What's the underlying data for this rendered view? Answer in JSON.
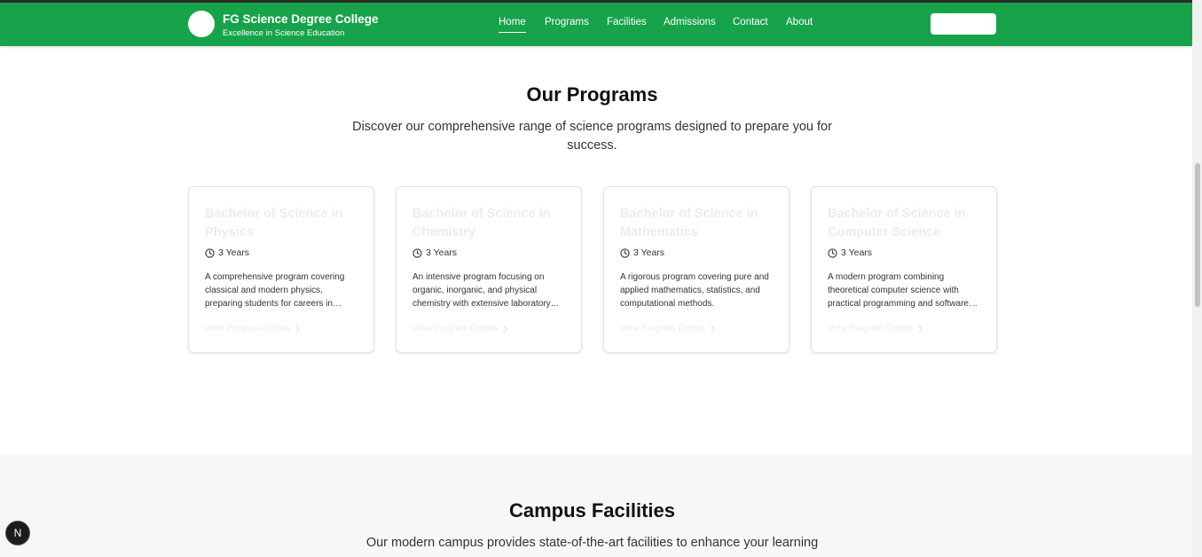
{
  "brand": {
    "title": "FG Science Degree College",
    "subtitle": "Excellence in Science Education"
  },
  "nav": {
    "links": [
      "Home",
      "Programs",
      "Facilities",
      "Admissions",
      "Contact",
      "About"
    ],
    "active": "Home"
  },
  "programs": {
    "title": "Our Programs",
    "description": "Discover our comprehensive range of science programs designed to prepare you for success.",
    "cards": [
      {
        "title": "Bachelor of Science in Physics",
        "duration": "3 Years",
        "description": "A comprehensive program covering classical and modern physics, preparing students for careers in research, industry, and academia.",
        "link": "View Program Details"
      },
      {
        "title": "Bachelor of Science in Chemistry",
        "duration": "3 Years",
        "description": "An intensive program focusing on organic, inorganic, and physical chemistry with extensive laboratory work.",
        "link": "View Program Details"
      },
      {
        "title": "Bachelor of Science in Mathematics",
        "duration": "3 Years",
        "description": "A rigorous program covering pure and applied mathematics, statistics, and computational methods.",
        "link": "View Program Details"
      },
      {
        "title": "Bachelor of Science in Computer Science",
        "duration": "3 Years",
        "description": "A modern program combining theoretical computer science with practical programming and software development.",
        "link": "View Program Details"
      }
    ]
  },
  "facilities": {
    "title": "Campus Facilities",
    "description": "Our modern campus provides state-of-the-art facilities to enhance your learning"
  },
  "dev_badge": "N",
  "colors": {
    "navbar": "#16a34a",
    "card_title": "#ececec",
    "section_alt_bg": "#f7f7f7"
  }
}
